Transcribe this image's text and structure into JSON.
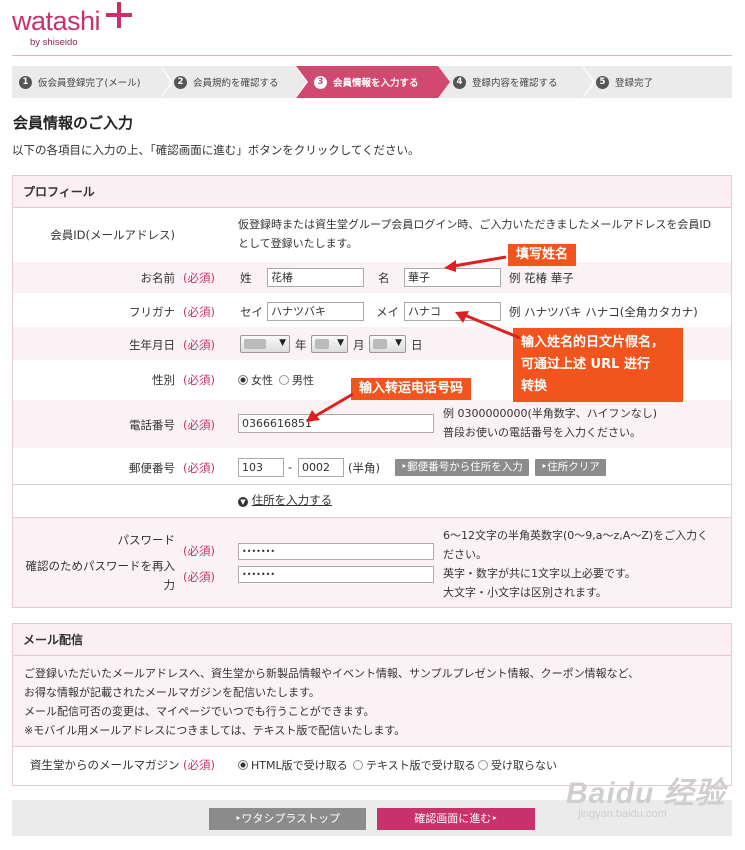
{
  "logo": {
    "name": "watashi",
    "sub": "by shiseido"
  },
  "steps": [
    {
      "num": "1",
      "label": "仮会員登録完了(メール)"
    },
    {
      "num": "2",
      "label": "会員規約を確認する"
    },
    {
      "num": "3",
      "label": "会員情報を入力する",
      "active": true
    },
    {
      "num": "4",
      "label": "登録内容を確認する"
    },
    {
      "num": "5",
      "label": "登録完了"
    }
  ],
  "page_title": "会員情報のご入力",
  "intro": "以下の各項目に入力の上、「確認画面に進む」ボタンをクリックしてください。",
  "profile": {
    "heading": "プロフィール",
    "member_id_label": "会員ID(メールアドレス)",
    "member_id_text": [
      "仮登録時または資生堂グループ会員ログイン時、ご入力いただきましたメールアドレスを会員ID",
      "として登録いたします。"
    ],
    "required": "(必須)",
    "name_label": "お名前",
    "sei_label": "姓",
    "sei_value": "花椿",
    "mei_label": "名",
    "mei_value": "華子",
    "name_example": "例 花椿 華子",
    "kana_label": "フリガナ",
    "kana_sei_label": "セイ",
    "kana_sei_value": "ハナツバキ",
    "kana_mei_label": "メイ",
    "kana_mei_value": "ハナコ",
    "kana_example": "例 ハナツバキ ハナコ(全角カタカナ)",
    "birthday_label": "生年月日",
    "year_unit": "年",
    "month_unit": "月",
    "day_unit": "日",
    "gender_label": "性別",
    "gender_female": "女性",
    "gender_male": "男性",
    "phone_label": "電話番号",
    "phone_value": "0366616851",
    "phone_note": [
      "例 0300000000(半角数字、ハイフンなし)",
      "普段お使いの電話番号を入力ください。"
    ],
    "zip_label": "郵便番号",
    "zip1": "103",
    "zip_dash": "-",
    "zip2": "0002",
    "zip_hankaku": "(半角)",
    "zip_btn": "郵便番号から住所を入力",
    "clear_btn": "住所クリア",
    "address_link": "住所を入力する",
    "pw_label": "パスワード",
    "pw_confirm_label": [
      "確認のためパスワードを再入",
      "力"
    ],
    "pw_value": "•••••••",
    "pw_note": [
      "6～12文字の半角英数字(0～9,a～z,A～Z)をご入力く",
      "ださい。",
      "英字・数字が共に1文字以上必要です。",
      "大文字・小文字は区別されます。"
    ]
  },
  "mail": {
    "heading": "メール配信",
    "text": [
      "ご登録いただいたメールアドレスへ、資生堂から新製品情報やイベント情報、サンプルプレゼント情報、クーポン情報など、",
      "お得な情報が記載されたメールマガジンを配信いたします。",
      "メール配信可否の変更は、マイページでいつでも行うことができます。",
      "※モバイル用メールアドレスにつきましては、テキスト版で配信いたします。"
    ],
    "magazine_label": "資生堂からのメールマガジン",
    "opt_html": "HTML版で受け取る",
    "opt_text": "テキスト版で受け取る",
    "opt_none": "受け取らない"
  },
  "buttons": {
    "back": "ワタシプラストップ",
    "next": "確認画面に進む"
  },
  "annotations": {
    "name": "填写姓名",
    "kana": [
      "输入姓名的日文片假名，",
      "可通过上述 URL 进行",
      "转换"
    ],
    "phone": "输入转运电话号码"
  },
  "watermark": {
    "big": "Baidu 经验",
    "small": "jingyan.baidu.com"
  },
  "colors": {
    "brand": "#c8326a",
    "annotation": "#f1541c",
    "panel_bg": "#fbeff3"
  }
}
